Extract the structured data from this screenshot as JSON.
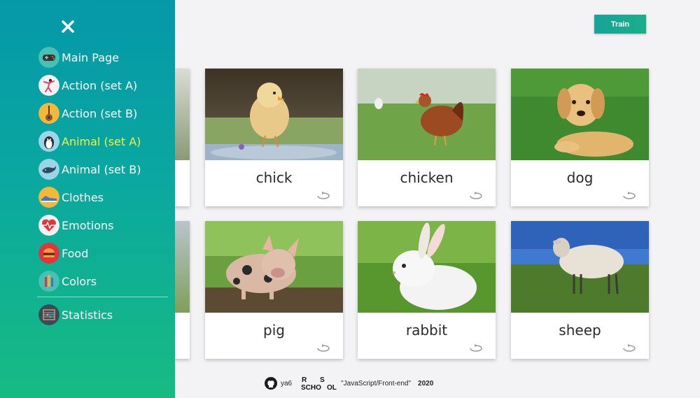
{
  "header": {
    "train_label": "Train"
  },
  "cards": [
    {
      "word": "chick"
    },
    {
      "word": "chicken"
    },
    {
      "word": "dog"
    },
    {
      "word": "pig"
    },
    {
      "word": "rabbit"
    },
    {
      "word": "sheep"
    }
  ],
  "sidebar": {
    "items": [
      {
        "label": "Main Page",
        "icon": "gamepad-icon"
      },
      {
        "label": "Action (set A)",
        "icon": "dancer-icon"
      },
      {
        "label": "Action (set B)",
        "icon": "guitar-icon"
      },
      {
        "label": "Animal (set A)",
        "icon": "penguin-icon",
        "active": true
      },
      {
        "label": "Animal (set B)",
        "icon": "whale-icon"
      },
      {
        "label": "Clothes",
        "icon": "shoe-icon"
      },
      {
        "label": "Emotions",
        "icon": "heart-monitor-icon"
      },
      {
        "label": "Food",
        "icon": "burger-icon"
      },
      {
        "label": "Colors",
        "icon": "pencils-icon"
      }
    ],
    "statistics_label": "Statistics",
    "statistics_icon": "abacus-icon",
    "active_color": "#f4f23a"
  },
  "footer": {
    "github_user": "ya6",
    "course": "\"JavaScript/Front-end\"",
    "year": "2020"
  },
  "colors": {
    "sidebar_top": "#0598a9",
    "sidebar_bottom": "#17bb82",
    "button": "#16a39a"
  }
}
